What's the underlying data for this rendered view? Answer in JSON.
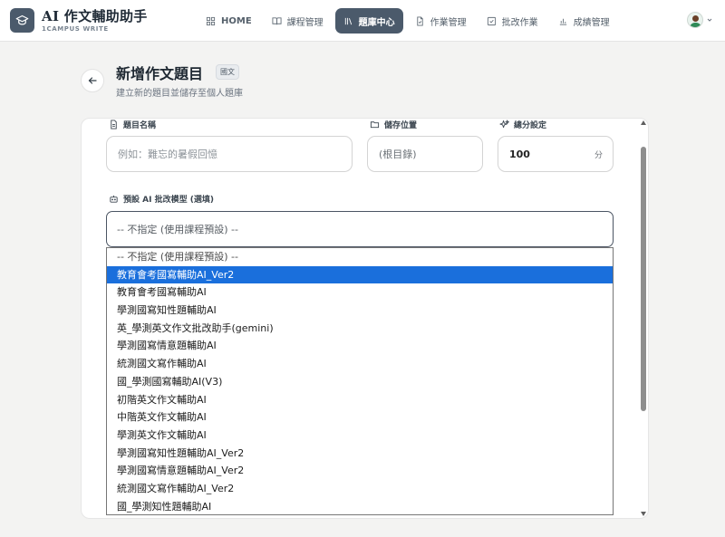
{
  "app": {
    "title": "AI 作文輔助助手",
    "subtitle": "1CAMPUS WRITE"
  },
  "nav": {
    "items": [
      {
        "label": "HOME",
        "icon": "grid-icon"
      },
      {
        "label": "課程管理",
        "icon": "book-icon"
      },
      {
        "label": "題庫中心",
        "icon": "library-icon",
        "active": true
      },
      {
        "label": "作業管理",
        "icon": "file-icon"
      },
      {
        "label": "批改作業",
        "icon": "check-square-icon"
      },
      {
        "label": "成績管理",
        "icon": "bar-chart-icon"
      }
    ]
  },
  "page": {
    "title": "新增作文題目",
    "badge": "國文",
    "subtitle": "建立新的題目並儲存至個人題庫"
  },
  "form": {
    "title_label": "題目名稱",
    "title_placeholder": "例如：難忘的暑假回憶",
    "location_label": "儲存位置",
    "location_value": "(根目錄)",
    "score_label": "總分設定",
    "score_value": "100",
    "score_unit": "分",
    "model_label": "預設 AI 批改模型 (選填)",
    "model_selected": "-- 不指定 (使用課程預設) --"
  },
  "dropdown": {
    "options": [
      "-- 不指定 (使用課程預設) --",
      "教育會考國寫輔助AI_Ver2",
      "教育會考國寫輔助AI",
      "學測國寫知性題輔助AI",
      "英_學測英文作文批改助手(gemini)",
      "學測國寫情意題輔助AI",
      "統測國文寫作輔助AI",
      "國_學測國寫輔助AI(V3)",
      "初階英文作文輔助AI",
      "中階英文作文輔助AI",
      "學測英文作文輔助AI",
      "學測國寫知性題輔助AI_Ver2",
      "學測國寫情意題輔助AI_Ver2",
      "統測國文寫作輔助AI_Ver2",
      "國_學測知性題輔助AI"
    ],
    "highlighted": "教育會考國寫輔助AI_Ver2"
  },
  "colors": {
    "accent": "#4b5a6b",
    "highlight": "#1a6fdc",
    "background": "#f3f3f2"
  }
}
